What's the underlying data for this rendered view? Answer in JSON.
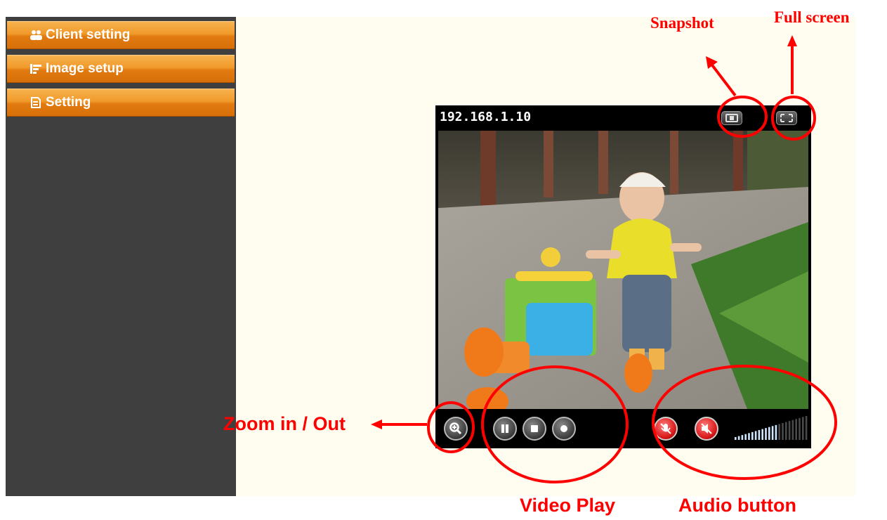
{
  "sidebar": {
    "items": [
      {
        "label": "Client setting",
        "icon": "users-icon"
      },
      {
        "label": "Image setup",
        "icon": "image-setup-icon"
      },
      {
        "label": "Setting",
        "icon": "settings-document-icon"
      }
    ]
  },
  "viewer": {
    "ip_address": "192.168.1.10",
    "top_buttons": [
      "snapshot-icon",
      "fullscreen-icon"
    ],
    "controls": [
      "zoom-icon",
      "pause-icon",
      "stop-icon",
      "record-icon"
    ],
    "audio_controls": [
      "microphone-mute-icon",
      "speaker-mute-icon"
    ],
    "volume_level": 0.55
  },
  "annotations": {
    "snapshot": "Snapshot",
    "full_screen": "Full screen",
    "zoom": "Zoom in / Out",
    "video_play": "Video Play",
    "audio_button": "Audio button"
  },
  "colors": {
    "annotation": "#ff0000",
    "menu_orange": "#f09a2a",
    "sidebar_bg": "#3f3f3f",
    "content_bg": "#fffdf0"
  }
}
